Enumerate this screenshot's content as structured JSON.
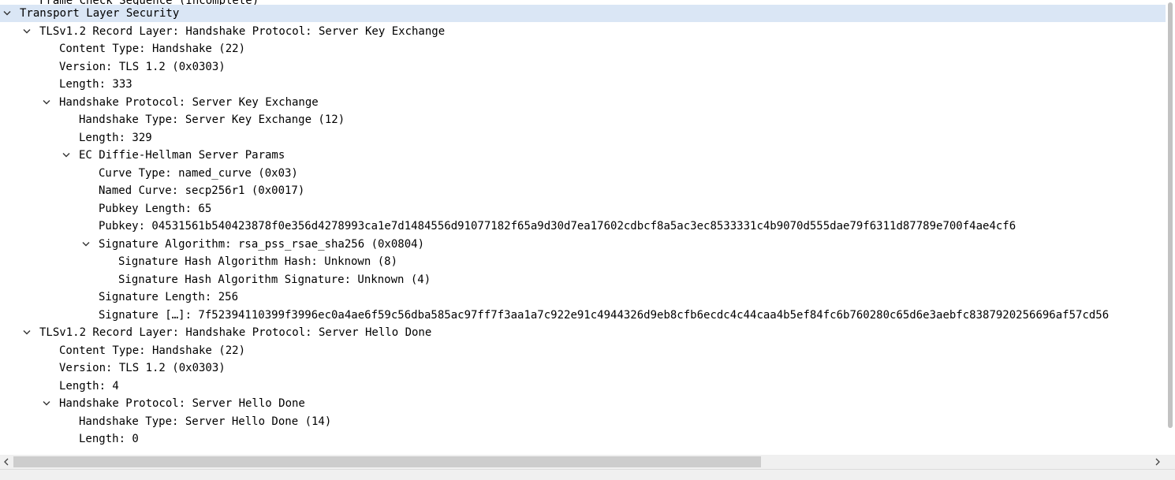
{
  "tree": {
    "partial_top_label": "Frame Check Sequence (Incomplete)",
    "rows": [
      {
        "label": "Transport Layer Security",
        "level": 0,
        "expandable": true,
        "selected": true
      },
      {
        "label": "TLSv1.2 Record Layer: Handshake Protocol: Server Key Exchange",
        "level": 1,
        "expandable": true
      },
      {
        "label": "Content Type: Handshake (22)",
        "level": 2
      },
      {
        "label": "Version: TLS 1.2 (0x0303)",
        "level": 2
      },
      {
        "label": "Length: 333",
        "level": 2
      },
      {
        "label": "Handshake Protocol: Server Key Exchange",
        "level": 2,
        "expandable": true
      },
      {
        "label": "Handshake Type: Server Key Exchange (12)",
        "level": 3
      },
      {
        "label": "Length: 329",
        "level": 3
      },
      {
        "label": "EC Diffie-Hellman Server Params",
        "level": 3,
        "expandable": true
      },
      {
        "label": "Curve Type: named_curve (0x03)",
        "level": 4
      },
      {
        "label": "Named Curve: secp256r1 (0x0017)",
        "level": 4
      },
      {
        "label": "Pubkey Length: 65",
        "level": 4
      },
      {
        "label": "Pubkey: 04531561b540423878f0e356d4278993ca1e7d1484556d91077182f65a9d30d7ea17602cdbcf8a5ac3ec8533331c4b9070d555dae79f6311d87789e700f4ae4cf6",
        "level": 4
      },
      {
        "label": "Signature Algorithm: rsa_pss_rsae_sha256 (0x0804)",
        "level": 4,
        "expandable": true
      },
      {
        "label": "Signature Hash Algorithm Hash: Unknown (8)",
        "level": 5
      },
      {
        "label": "Signature Hash Algorithm Signature: Unknown (4)",
        "level": 5
      },
      {
        "label": "Signature Length: 256",
        "level": 4
      },
      {
        "label": "Signature […]: 7f52394110399f3996ec0a4ae6f59c56dba585ac97ff7f3aa1a7c922e91c4944326d9eb8cfb6ecdc4c44caa4b5ef84fc6b760280c65d6e3aebfc8387920256696af57cd56",
        "level": 4
      },
      {
        "label": "TLSv1.2 Record Layer: Handshake Protocol: Server Hello Done",
        "level": 1,
        "expandable": true
      },
      {
        "label": "Content Type: Handshake (22)",
        "level": 2
      },
      {
        "label": "Version: TLS 1.2 (0x0303)",
        "level": 2
      },
      {
        "label": "Length: 4",
        "level": 2
      },
      {
        "label": "Handshake Protocol: Server Hello Done",
        "level": 2,
        "expandable": true
      },
      {
        "label": "Handshake Type: Server Hello Done (14)",
        "level": 3
      },
      {
        "label": "Length: 0",
        "level": 3
      }
    ]
  },
  "colors": {
    "selected_row": "#dae6f5",
    "scrollbar_thumb": "#cdcdcd",
    "scrollbar_track": "#f0f0f0"
  },
  "icons": {
    "expand_arrow": "chevron-down-icon",
    "scroll_left": "chevron-left-icon",
    "scroll_right": "chevron-right-icon"
  }
}
